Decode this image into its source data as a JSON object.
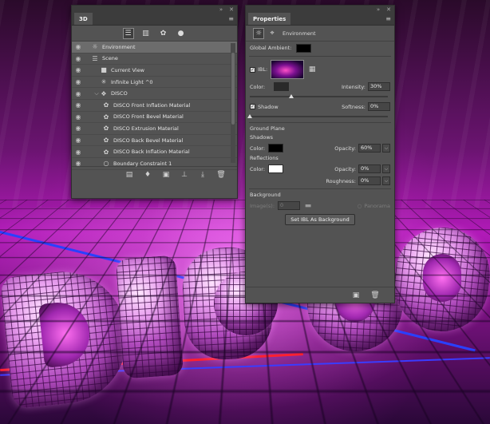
{
  "panel3d": {
    "tab": "3D",
    "toolbar": [
      "scene-filter-icon",
      "mesh-filter-icon",
      "material-filter-icon",
      "light-filter-icon"
    ],
    "items": [
      {
        "label": "Environment",
        "icon": "environment-icon",
        "visible": true,
        "selected": true,
        "indent": 0
      },
      {
        "label": "Scene",
        "icon": "scene-icon",
        "visible": true,
        "selected": false,
        "indent": 0
      },
      {
        "label": "Current View",
        "icon": "camera-icon",
        "visible": true,
        "selected": false,
        "indent": 1
      },
      {
        "label": "Infinite Light ^0",
        "icon": "infinite-light-icon",
        "visible": true,
        "selected": false,
        "indent": 1
      },
      {
        "label": "DISCO",
        "icon": "mesh-icon",
        "visible": true,
        "selected": false,
        "indent": 1,
        "expanded": true
      },
      {
        "label": "DISCO Front Inflation Material",
        "icon": "material-icon",
        "visible": true,
        "selected": false,
        "indent": 2
      },
      {
        "label": "DISCO Front Bevel Material",
        "icon": "material-icon",
        "visible": true,
        "selected": false,
        "indent": 2
      },
      {
        "label": "DISCO Extrusion Material",
        "icon": "material-icon",
        "visible": true,
        "selected": false,
        "indent": 2
      },
      {
        "label": "DISCO Back Bevel Material",
        "icon": "material-icon",
        "visible": true,
        "selected": false,
        "indent": 2
      },
      {
        "label": "DISCO Back Inflation Material",
        "icon": "material-icon",
        "visible": true,
        "selected": false,
        "indent": 2
      },
      {
        "label": "Boundary Constraint 1",
        "icon": "constraint-icon",
        "visible": true,
        "selected": false,
        "indent": 2
      }
    ],
    "bottom_icons": [
      "add-mesh-icon",
      "add-light-icon",
      "render-icon",
      "move-to-ground-icon",
      "drop-to-plane-icon",
      "delete-icon"
    ]
  },
  "properties": {
    "tab": "Properties",
    "mode": "Environment",
    "global_ambient_label": "Global Ambient:",
    "ibl_label": "IBL:",
    "ibl_checked": true,
    "color_label": "Color:",
    "intensity_label": "Intensity:",
    "intensity": "30%",
    "intensity_fraction": 0.3,
    "shadow_label": "Shadow",
    "shadow_checked": true,
    "softness_label": "Softness:",
    "softness": "0%",
    "softness_fraction": 0.0,
    "ground_plane_label": "Ground Plane",
    "shadows_label": "Shadows",
    "shadows_color_label": "Color:",
    "shadows_opacity_label": "Opacity:",
    "shadows_opacity": "60%",
    "reflections_label": "Reflections",
    "reflections_color_label": "Color:",
    "reflections_opacity_label": "Opacity:",
    "reflections_opacity": "0%",
    "roughness_label": "Roughness:",
    "roughness": "0%",
    "background_label": "Background",
    "image_label": "Image(s):",
    "image_value": "0",
    "panorama_label": "Panorama",
    "set_ibl_button": "Set IBL As Background",
    "colors": {
      "global_ambient": "#000000",
      "ibl_color": "#000000",
      "shadows_color": "#000000",
      "reflections_color": "#ffffff"
    }
  },
  "scene_text": "DISCO"
}
